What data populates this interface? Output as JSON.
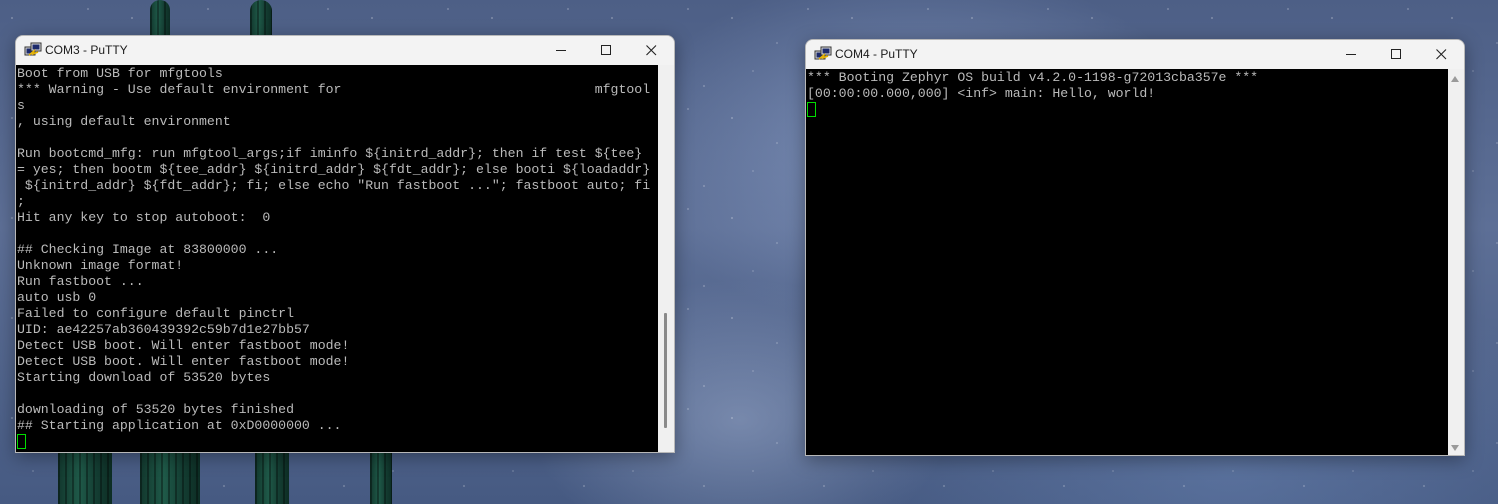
{
  "desktop": {
    "wallpaper": "night-sky-cactus"
  },
  "windows": [
    {
      "title": "COM3 - PuTTY",
      "icon": "putty-icon",
      "controls": {
        "minimize": "minimize-icon",
        "maximize": "maximize-icon",
        "close": "close-icon"
      },
      "scroll_position": 0.92,
      "lines": [
        "Boot from USB for mfgtools",
        "*** Warning - Use default environment for                                mfgtool",
        "s",
        ", using default environment",
        "",
        "Run bootcmd_mfg: run mfgtool_args;if iminfo ${initrd_addr}; then if test ${tee}",
        "= yes; then bootm ${tee_addr} ${initrd_addr} ${fdt_addr}; else booti ${loadaddr}",
        " ${initrd_addr} ${fdt_addr}; fi; else echo \"Run fastboot ...\"; fastboot auto; fi",
        ";",
        "Hit any key to stop autoboot:  0",
        "",
        "## Checking Image at 83800000 ...",
        "Unknown image format!",
        "Run fastboot ...",
        "auto usb 0",
        "Failed to configure default pinctrl",
        "UID: ae42257ab360439392c59b7d1e27bb57",
        "Detect USB boot. Will enter fastboot mode!",
        "Detect USB boot. Will enter fastboot mode!",
        "Starting download of 53520 bytes",
        "",
        "downloading of 53520 bytes finished",
        "## Starting application at 0xD0000000 ..."
      ]
    },
    {
      "title": "COM4 - PuTTY",
      "icon": "putty-icon",
      "controls": {
        "minimize": "minimize-icon",
        "maximize": "maximize-icon",
        "close": "close-icon"
      },
      "lines": [
        "*** Booting Zephyr OS build v4.2.0-1198-g72013cba357e ***",
        "[00:00:00.000,000] <inf> main: Hello, world!"
      ]
    }
  ],
  "colors": {
    "terminal_bg": "#000000",
    "terminal_fg": "#bbbbbb",
    "cursor": "#00dd00",
    "titlebar": "#f3f3f3"
  }
}
